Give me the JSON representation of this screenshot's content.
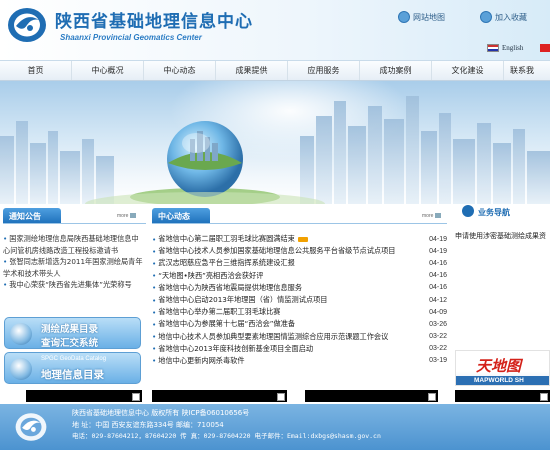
{
  "header": {
    "title_cn": "陕西省基础地理信息中心",
    "title_en": "Shaanxi Provincial Geomatics Center",
    "links": [
      {
        "label": "网站地图"
      },
      {
        "label": "加入收藏"
      }
    ],
    "language": "English"
  },
  "nav": {
    "items": [
      {
        "label": "首页"
      },
      {
        "label": "中心概况"
      },
      {
        "label": "中心动态"
      },
      {
        "label": "成果提供"
      },
      {
        "label": "应用服务"
      },
      {
        "label": "成功案例"
      },
      {
        "label": "文化建设"
      },
      {
        "label": "联系我"
      }
    ]
  },
  "notice": {
    "title": "通知公告",
    "more": "more",
    "items": [
      {
        "text": "国家测绘地理信息局陕西基础地理信息中"
      },
      {
        "text": "心问管机房线路改造工程投标邀请书"
      },
      {
        "text": "张智同志新增选为2011年国家测绘局青年"
      },
      {
        "text": "学术和技术带头人"
      },
      {
        "text": "我中心荣获“陕西省先进集体”光荣称号"
      }
    ]
  },
  "buttons": {
    "results": {
      "line1": "测绘成果目录",
      "line2": "查询汇交系统"
    },
    "catalog": {
      "line0": "SPGC GeoData Catalog",
      "line1": "地理信息目录"
    }
  },
  "news": {
    "title": "中心动态",
    "more": "more",
    "items": [
      {
        "text": "省地信中心第二届职工羽毛球比赛圆满结束",
        "date": "04-19",
        "isnew": true
      },
      {
        "text": "省地信中心技术人员参加国家基础地理信息公共服务平台省级节点试点项目",
        "date": "04-19"
      },
      {
        "text": "武汉志昭慈应急平台三维指挥系统建设汇报",
        "date": "04-16"
      },
      {
        "text": "“天地图•陕西”亮相西洽会获好评",
        "date": "04-16"
      },
      {
        "text": "省地信中心为陕西省地震局提供地理信息服务",
        "date": "04-16"
      },
      {
        "text": "省地信中心启动2013年地理国（省）情监测试点项目",
        "date": "04-12"
      },
      {
        "text": "省地信中心举办第二届职工羽毛球比赛",
        "date": "04-09"
      },
      {
        "text": "省地信中心为参展第十七届“西洽会”做准备",
        "date": "03-26"
      },
      {
        "text": "地信中心技术人员参加典型要素地理国情监测综合应用示范课题工作会议",
        "date": "03-22"
      },
      {
        "text": "省地信中心2013年度科技创新基金项目全面启动",
        "date": "03-22"
      },
      {
        "text": "地信中心更新内网杀毒软件",
        "date": "03-19"
      }
    ]
  },
  "guide": {
    "title": "业务导航",
    "text": "申请使用涉密基础测绘成果资"
  },
  "mapworld": {
    "cn": "天地图",
    "en": "MAPWORLD SH"
  },
  "footer": {
    "line1": "陕西省基础地理信息中心 版权所有 陕ICP备06010656号",
    "line2": "地 址：中国 西安友谊东路334号 邮编：710054",
    "line3": "电话：029-87604212，87604220 传 真：029-87604220 电子邮件：Email:dxbgs@shasm.gov.cn"
  },
  "colors": {
    "brand_blue": "#1f6db3",
    "footer_blue": "#5a9dd6",
    "accent_red": "#d4221a"
  }
}
